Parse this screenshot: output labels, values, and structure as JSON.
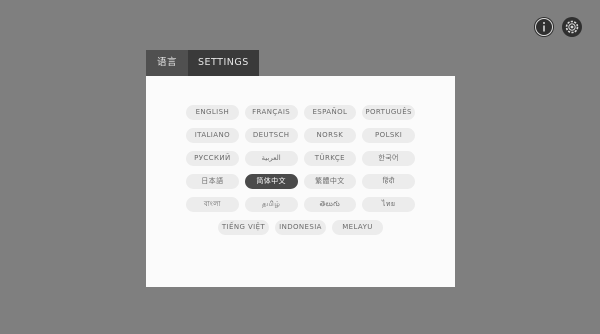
{
  "tabs": {
    "language": "语言",
    "settings": "SETTINGS"
  },
  "top_icons": [
    "info-icon",
    "gear-icon"
  ],
  "languages": {
    "row1": [
      "ENGLISH",
      "FRANÇAIS",
      "ESPAÑOL",
      "PORTUGUÊS"
    ],
    "row2": [
      "ITALIANO",
      "DEUTSCH",
      "NORSK",
      "POLSKI"
    ],
    "row3": [
      "РУССКИЙ",
      "العربية",
      "TÜRKÇE",
      "한국어"
    ],
    "row4": [
      "日本語",
      "简体中文",
      "繁體中文",
      "हिंदी"
    ],
    "row5": [
      "বাংলা",
      "தமிழ்",
      "తెలుగు",
      "ไทย"
    ],
    "row6": [
      "TIẾNG VIỆT",
      "INDONESIA",
      "MELAYU"
    ]
  },
  "selected_language": "简体中文",
  "colors": {
    "background": "#7f7f7f",
    "panel": "#fbfbfb",
    "selected": "#4a4a4a"
  }
}
